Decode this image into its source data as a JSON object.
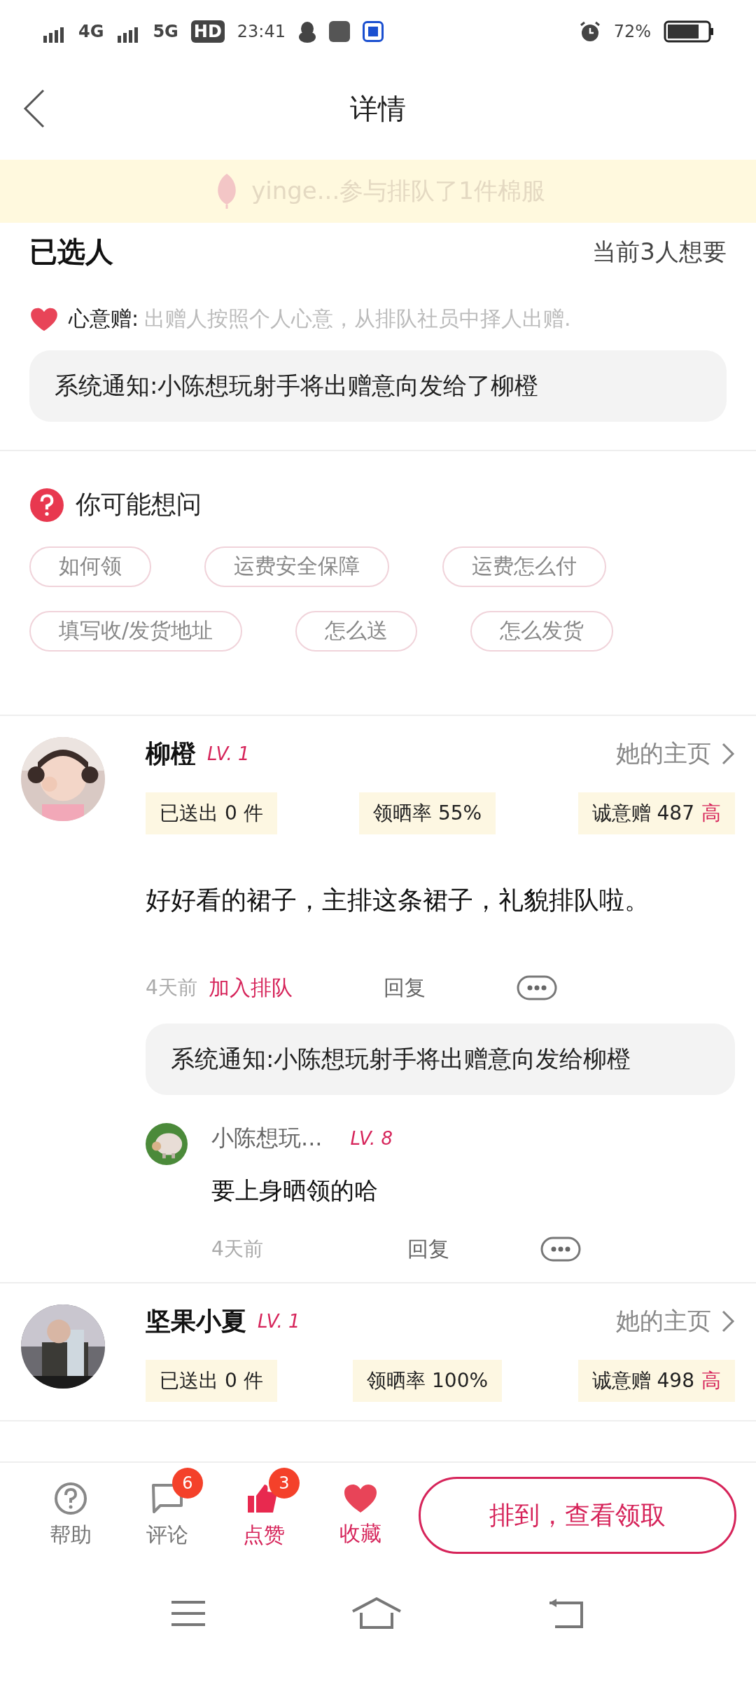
{
  "status_bar": {
    "network_1": "4G",
    "network_2": "5G",
    "hd": "HD",
    "time": "23:41",
    "battery": "72%"
  },
  "nav": {
    "title": "详情"
  },
  "toast": {
    "text": "yinge...参与排队了1件棉服"
  },
  "selection": {
    "title": "已选人",
    "count": "当前3人想要",
    "rule_label": "心意赠:",
    "rule_text": "出赠人按照个人心意，从排队社员中择人出赠.",
    "notice": "系统通知:小陈想玩射手将出赠意向发给了柳橙"
  },
  "faq": {
    "title": "你可能想问",
    "chips": [
      "如何领",
      "运费安全保障",
      "运费怎么付",
      "填写收/发货地址",
      "怎么送",
      "怎么发货"
    ]
  },
  "comments": [
    {
      "name": "柳橙",
      "level": "LV. 1",
      "homepage": "她的主页",
      "sent": "已送出 0 件",
      "rate": "领晒率 55%",
      "sincerity": "诚意赠 487",
      "sincerity_level": "高",
      "text": "好好看的裙子，主排这条裙子，礼貌排队啦。",
      "time": "4天前",
      "action": "加入排队",
      "reply": "回复",
      "notice": "系统通知:小陈想玩射手将出赠意向发给柳橙",
      "replies": [
        {
          "name": "小陈想玩...",
          "level": "LV. 8",
          "text": "要上身晒领的哈",
          "time": "4天前",
          "reply": "回复"
        }
      ]
    },
    {
      "name": "坚果小夏",
      "level": "LV. 1",
      "homepage": "她的主页",
      "sent": "已送出 0 件",
      "rate": "领晒率 100%",
      "sincerity": "诚意赠 498",
      "sincerity_level": "高"
    }
  ],
  "bottom_bar": {
    "items": [
      {
        "kind": "help",
        "label": "帮助",
        "on": false
      },
      {
        "kind": "comment",
        "label": "评论",
        "badge": "6",
        "on": false
      },
      {
        "kind": "like",
        "label": "点赞",
        "badge": "3",
        "on": true
      },
      {
        "kind": "favorite",
        "label": "收藏",
        "on": true
      }
    ],
    "cta": "排到，查看领取"
  }
}
